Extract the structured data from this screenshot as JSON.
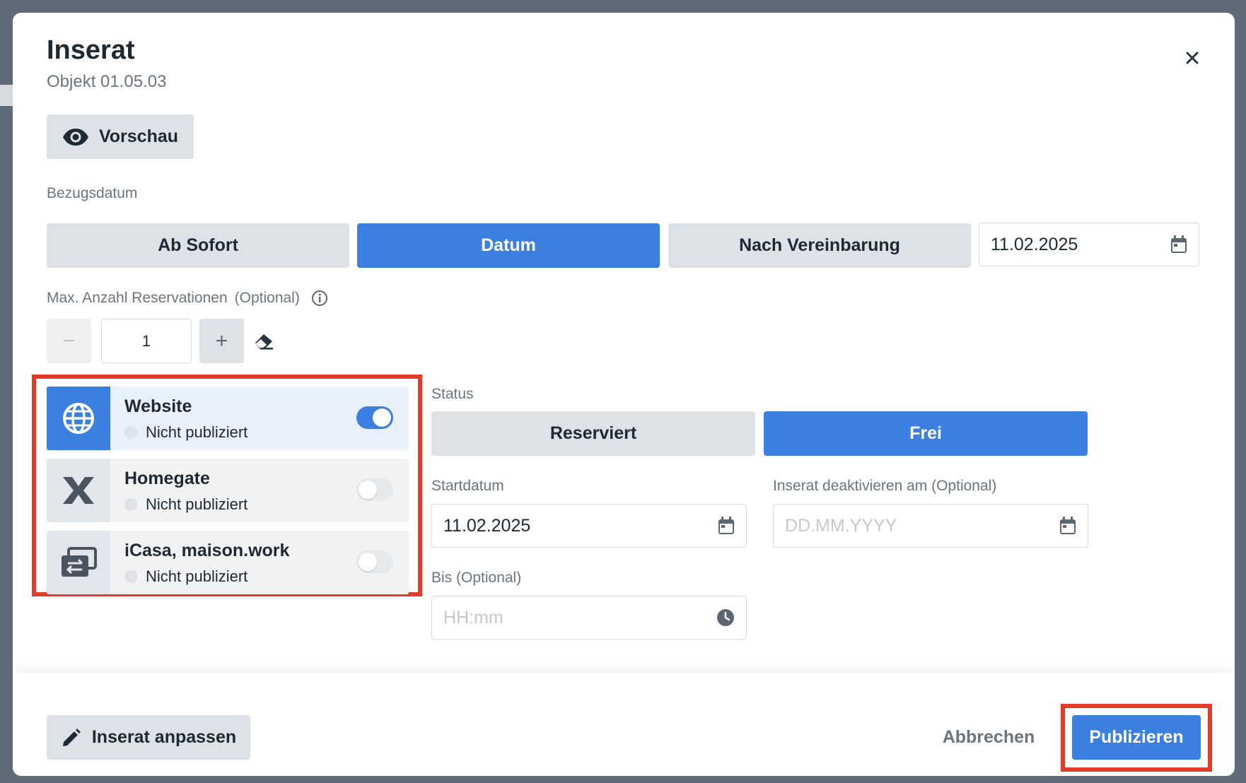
{
  "modal": {
    "title": "Inserat",
    "subtitle": "Objekt 01.05.03",
    "close_icon": "close-icon"
  },
  "preview": {
    "label": "Vorschau",
    "icon": "eye-icon"
  },
  "move_in": {
    "label": "Bezugsdatum",
    "options": [
      "Ab Sofort",
      "Datum",
      "Nach Vereinbarung"
    ],
    "selected": "Datum",
    "date_value": "11.02.2025"
  },
  "reservations": {
    "label": "Max. Anzahl Reservationen",
    "optional": "(Optional)",
    "value": "1",
    "minus": "−",
    "plus": "+"
  },
  "channels": [
    {
      "name": "Website",
      "status": "Nicht publiziert",
      "enabled": true,
      "icon": "globe-icon"
    },
    {
      "name": "Homegate",
      "status": "Nicht publiziert",
      "enabled": false,
      "icon": "homegate-x-icon"
    },
    {
      "name": "iCasa, maison.work",
      "status": "Nicht publiziert",
      "enabled": false,
      "icon": "exchange-icon"
    }
  ],
  "status": {
    "label": "Status",
    "options": [
      "Reserviert",
      "Frei"
    ],
    "selected": "Frei"
  },
  "start_date": {
    "label": "Startdatum",
    "value": "11.02.2025"
  },
  "deactivate": {
    "label": "Inserat deaktivieren am (Optional)",
    "placeholder": "DD.MM.YYYY"
  },
  "until": {
    "label": "Bis (Optional)",
    "placeholder": "HH:mm"
  },
  "footer": {
    "edit_label": "Inserat anpassen",
    "cancel_label": "Abbrechen",
    "publish_label": "Publizieren"
  },
  "colors": {
    "accent": "#3b7fe0",
    "highlight": "#e23b2a",
    "button_gray": "#dde2e6"
  }
}
